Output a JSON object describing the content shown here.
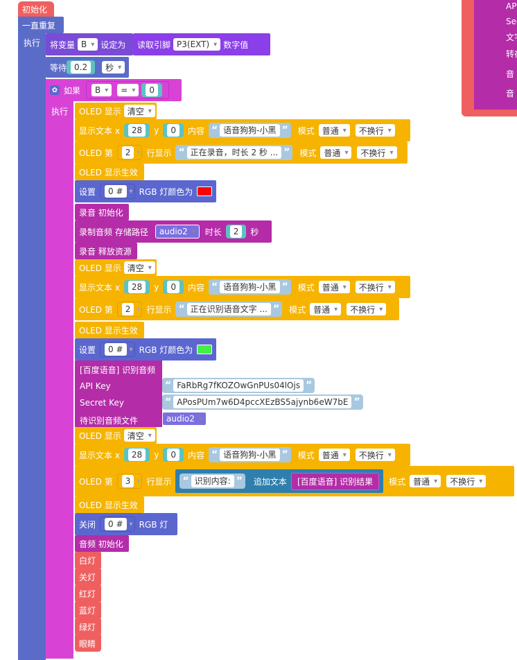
{
  "init_hat": "初始化",
  "forever": "一直重复",
  "exec": "执行",
  "if_exec": "执行",
  "set_var": {
    "prefix": "将变量",
    "var": "B",
    "suffix": "设定为"
  },
  "read_pin": {
    "label": "读取引脚",
    "pin": "P3(EXT)",
    "suffix": "数字值"
  },
  "wait": {
    "label": "等待",
    "value": "0.2",
    "unit": "秒"
  },
  "if_block": {
    "label": "如果",
    "var": "B",
    "op": "=",
    "value": "0"
  },
  "oled_clear_label": "OLED 显示",
  "oled_clear_value": "清空",
  "show_text": {
    "label": "显示文本 x",
    "x": "28",
    "y_label": "y",
    "y": "0",
    "content_label": "内容",
    "content": "语音狗狗-小黑",
    "mode_label": "模式",
    "mode": "普通",
    "wrap": "不换行"
  },
  "oled_line_label": "OLED 第",
  "oled_line_suffix": "行显示",
  "line1": {
    "line": "2",
    "text": "正在录音，时长 2 秒 ..."
  },
  "line2": {
    "line": "2",
    "text": "正在识别语音文字 ..."
  },
  "oled_commit": "OLED 显示生效",
  "rgb_set": {
    "prefix": "设置",
    "index": "0 #",
    "suffix": "RGB 灯颜色为"
  },
  "color_red": "#ff0000",
  "color_green": "#44ee44",
  "rec_init": "录音 初始化",
  "rec_audio": {
    "label": "录制音频 存储路径",
    "path": "audio2",
    "dur_label": "时长",
    "dur": "2",
    "unit": "秒"
  },
  "rec_release": "录音 释放资源",
  "baidu": {
    "title": "[百度语音] 识别音频",
    "api_label": "API Key",
    "api_value": "FaRbRg7fKOZOwGnPUs04lOjs",
    "secret_label": "Secret Key",
    "secret_value": "APosPUm7w6D4pccXEzBS5ajynb6eW7bE",
    "file_label": "待识别音频文件",
    "file_value": "audio2"
  },
  "line3": {
    "line": "3",
    "prefix": "识别内容:",
    "append": "追加文本",
    "result": "[百度语音] 识别结果"
  },
  "rgb_off": {
    "prefix": "关闭",
    "index": "0 #",
    "suffix": "RGB 灯"
  },
  "audio_init": "音频 初始化",
  "lights": [
    "白灯",
    "关灯",
    "红灯",
    "蓝灯",
    "绿灯",
    "眼睛"
  ],
  "side_panel": [
    "API",
    "Sec",
    "文字",
    "转存",
    "音",
    "音"
  ]
}
